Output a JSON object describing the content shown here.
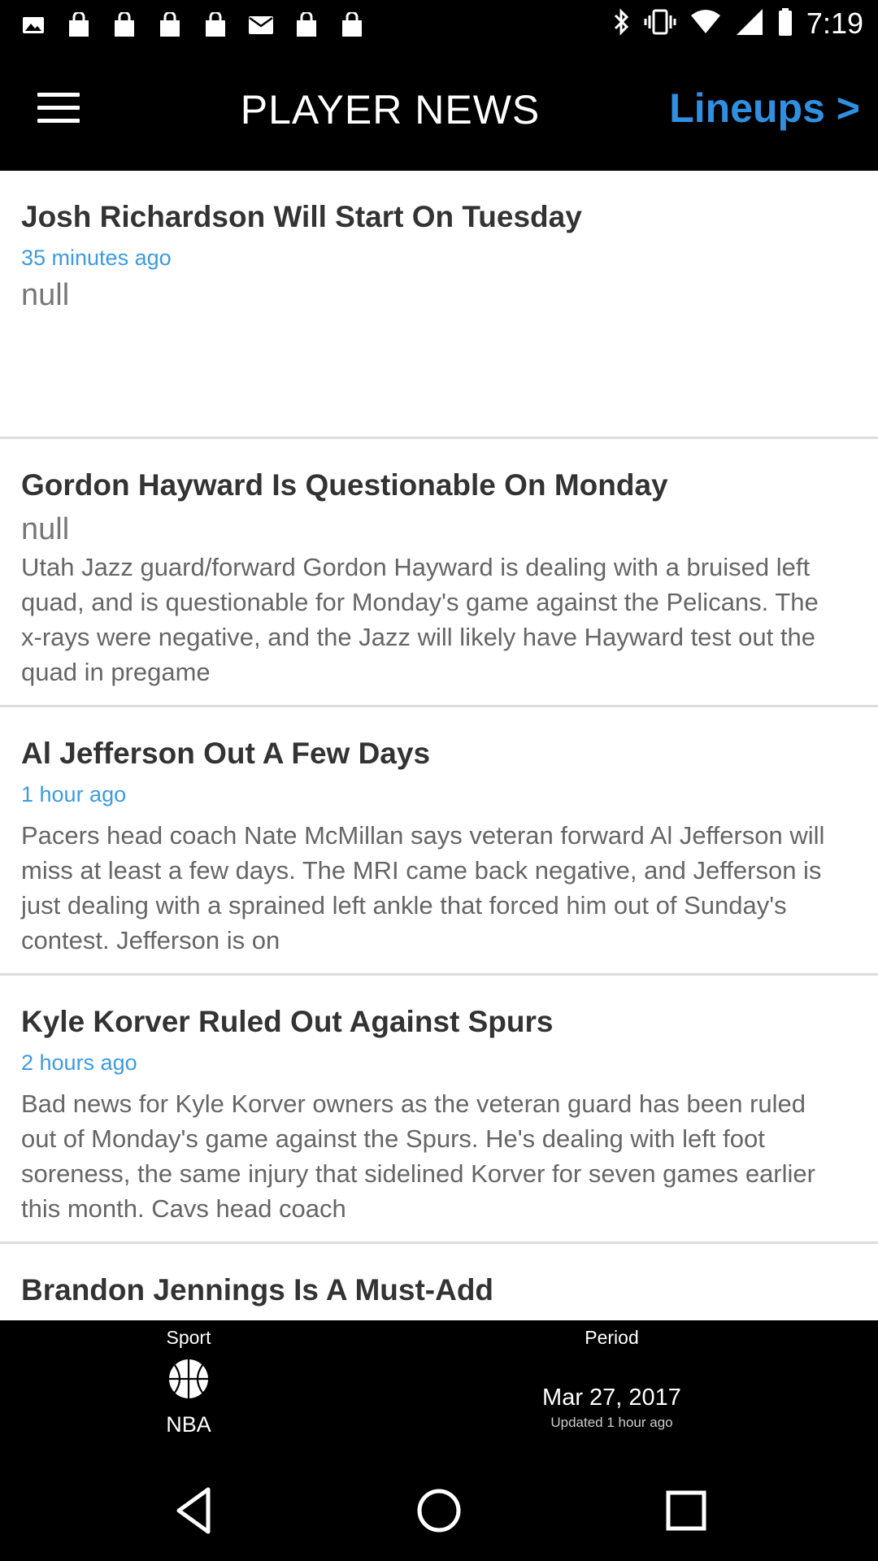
{
  "status_bar": {
    "time": "7:19",
    "icons": [
      "image-icon",
      "bag-icon",
      "bag-icon",
      "bag-icon",
      "bag-icon",
      "mail-icon",
      "bag-icon",
      "bag-icon",
      "bluetooth-icon",
      "vibrate-icon",
      "wifi-icon",
      "signal-icon",
      "battery-icon"
    ]
  },
  "app_bar": {
    "menu_icon": "hamburger-menu-icon",
    "title": "PLAYER NEWS",
    "lineups_label": "Lineups >"
  },
  "news": [
    {
      "title": "Josh Richardson Will Start On Tuesday",
      "time": "35 minutes ago",
      "null_label": "null",
      "body": ""
    },
    {
      "title": "Gordon Hayward Is Questionable On Monday",
      "time": "",
      "null_label": "null",
      "body": "Utah Jazz guard/forward Gordon Hayward is dealing with a bruised left quad, and is questionable for Monday's game against the Pelicans. The x-rays were negative, and the Jazz will likely have Hayward test out the quad in pregame"
    },
    {
      "title": "Al Jefferson Out A Few Days",
      "time": "1 hour ago",
      "null_label": "",
      "body": "Pacers head coach Nate McMillan says veteran forward Al Jefferson will miss at least a few days. The MRI came back negative, and Jefferson is just dealing with a sprained left ankle that forced him out of Sunday's contest. Jefferson is on"
    },
    {
      "title": "Kyle Korver Ruled Out Against Spurs",
      "time": "2 hours ago",
      "null_label": "",
      "body": "Bad news for Kyle Korver owners as the veteran guard has been ruled out of Monday's game against the Spurs. He's dealing with left foot soreness, the same injury that sidelined Korver for seven games earlier this month. Cavs head coach"
    },
    {
      "title": "Brandon Jennings Is A Must-Add",
      "time": "",
      "null_label": "",
      "body": ""
    }
  ],
  "bottom_panel": {
    "sport_label": "Sport",
    "sport_icon": "basketball-icon",
    "sport_value": "NBA",
    "period_label": "Period",
    "period_date": "Mar 27, 2017",
    "period_updated": "Updated 1 hour ago"
  },
  "nav_bar": {
    "back_icon": "back-triangle-icon",
    "home_icon": "home-circle-icon",
    "recents_icon": "recents-square-icon"
  },
  "colors": {
    "accent": "#3d9be0",
    "lineups": "#2f8fe0",
    "bar": "#000000"
  }
}
